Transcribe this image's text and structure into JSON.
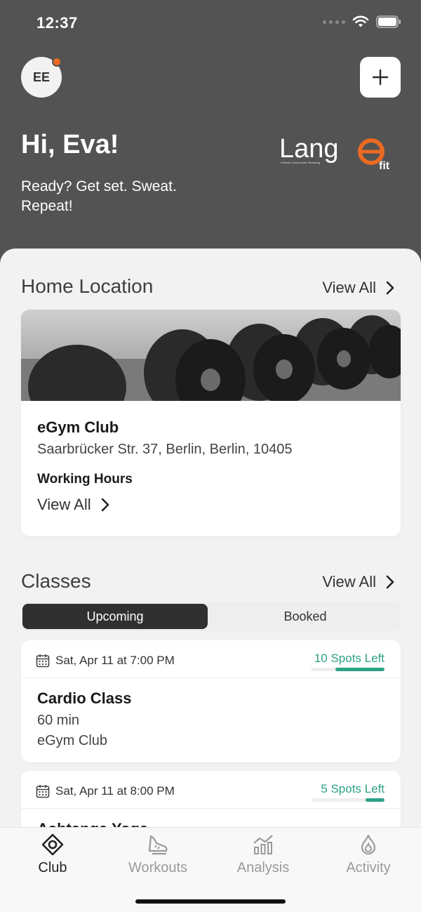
{
  "status_bar": {
    "time": "12:37"
  },
  "header": {
    "avatar_initials": "EE",
    "greeting": "Hi, Eva!",
    "subtitle": "Ready? Get set. Sweat. Repeat!",
    "logo_text": "Lang",
    "logo_e": "e",
    "logo_fit": "fit",
    "logo_tagline": "•Fitness •Gesundheit •Beratung"
  },
  "home_location": {
    "title": "Home Location",
    "view_all": "View All",
    "club_name": "eGym Club",
    "address": "Saarbrücker Str. 37, Berlin, Berlin, 10405",
    "working_hours_label": "Working Hours",
    "working_hours_link": "View All"
  },
  "classes": {
    "title": "Classes",
    "view_all": "View All",
    "tabs": [
      {
        "label": "Upcoming",
        "active": true
      },
      {
        "label": "Booked",
        "active": false
      }
    ],
    "items": [
      {
        "date": "Sat, Apr 11 at 7:00 PM",
        "spots": "10 Spots Left",
        "spots_fill": 0.67,
        "name": "Cardio Class",
        "duration": "60 min",
        "location": "eGym Club"
      },
      {
        "date": "Sat, Apr 11 at 8:00 PM",
        "spots": "5 Spots Left",
        "spots_fill": 0.26,
        "name": "Ashtanga Yoga",
        "duration": "",
        "location": ""
      }
    ]
  },
  "tabbar": {
    "items": [
      {
        "label": "Club",
        "icon": "club-icon",
        "active": true
      },
      {
        "label": "Workouts",
        "icon": "workouts-icon",
        "active": false
      },
      {
        "label": "Analysis",
        "icon": "analysis-icon",
        "active": false
      },
      {
        "label": "Activity",
        "icon": "activity-icon",
        "active": false
      }
    ]
  },
  "colors": {
    "header_bg": "#535353",
    "accent_orange": "#ea6a22",
    "spots_green": "#2ea286",
    "background": "#f2f2f2"
  }
}
